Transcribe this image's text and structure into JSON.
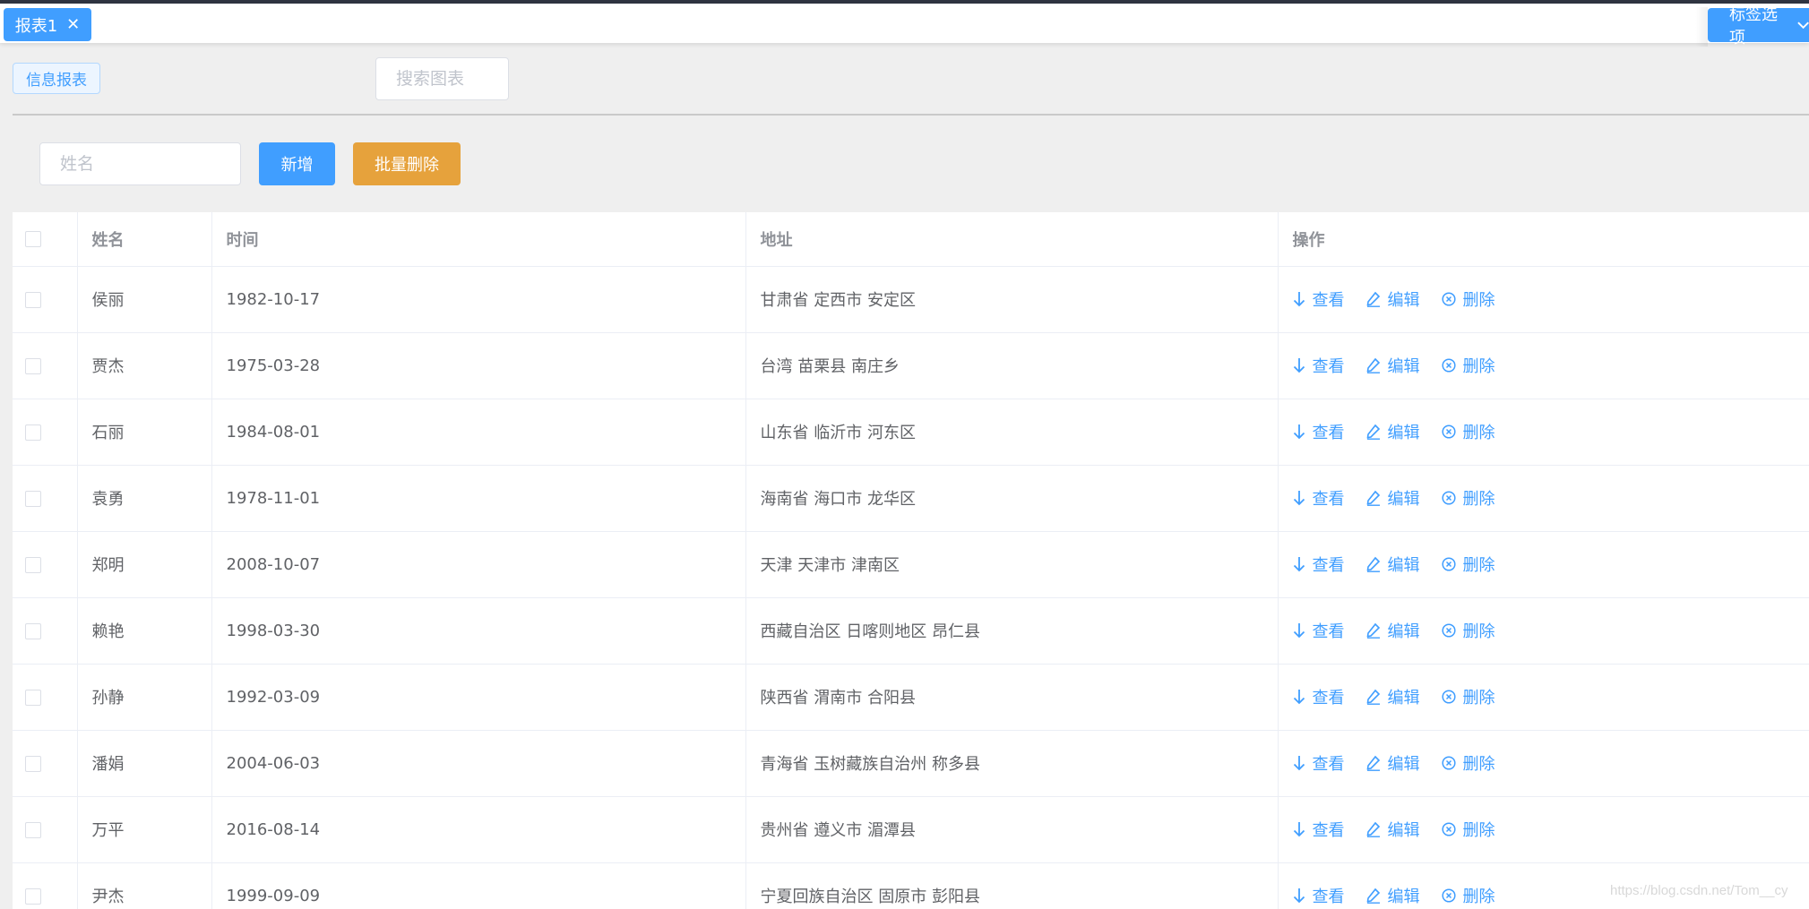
{
  "tabs": [
    {
      "label": "报表1"
    }
  ],
  "tab_options_label": "标签选项",
  "breadcrumb": {
    "tag_label": "信息报表"
  },
  "chart_search": {
    "placeholder": "搜索图表"
  },
  "toolbar": {
    "name_placeholder": "姓名",
    "add_label": "新增",
    "batch_delete_label": "批量删除"
  },
  "table": {
    "headers": {
      "name": "姓名",
      "time": "时间",
      "address": "地址",
      "actions": "操作"
    },
    "action_labels": {
      "view": "查看",
      "edit": "编辑",
      "delete": "删除"
    },
    "rows": [
      {
        "name": "侯丽",
        "time": "1982-10-17",
        "address": "甘肃省 定西市 安定区"
      },
      {
        "name": "贾杰",
        "time": "1975-03-28",
        "address": "台湾 苗栗县 南庄乡"
      },
      {
        "name": "石丽",
        "time": "1984-08-01",
        "address": "山东省 临沂市 河东区"
      },
      {
        "name": "袁勇",
        "time": "1978-11-01",
        "address": "海南省 海口市 龙华区"
      },
      {
        "name": "郑明",
        "time": "2008-10-07",
        "address": "天津 天津市 津南区"
      },
      {
        "name": "赖艳",
        "time": "1998-03-30",
        "address": "西藏自治区 日喀则地区 昂仁县"
      },
      {
        "name": "孙静",
        "time": "1992-03-09",
        "address": "陕西省 渭南市 合阳县"
      },
      {
        "name": "潘娟",
        "time": "2004-06-03",
        "address": "青海省 玉树藏族自治州 称多县"
      },
      {
        "name": "万平",
        "time": "2016-08-14",
        "address": "贵州省 遵义市 湄潭县"
      },
      {
        "name": "尹杰",
        "time": "1999-09-09",
        "address": "宁夏回族自治区 固原市 彭阳县"
      }
    ]
  },
  "watermark": "https://blog.csdn.net/Tom__cy",
  "colors": {
    "primary": "#409eff",
    "warning": "#e6a23c",
    "topbar": "#2f3441"
  }
}
